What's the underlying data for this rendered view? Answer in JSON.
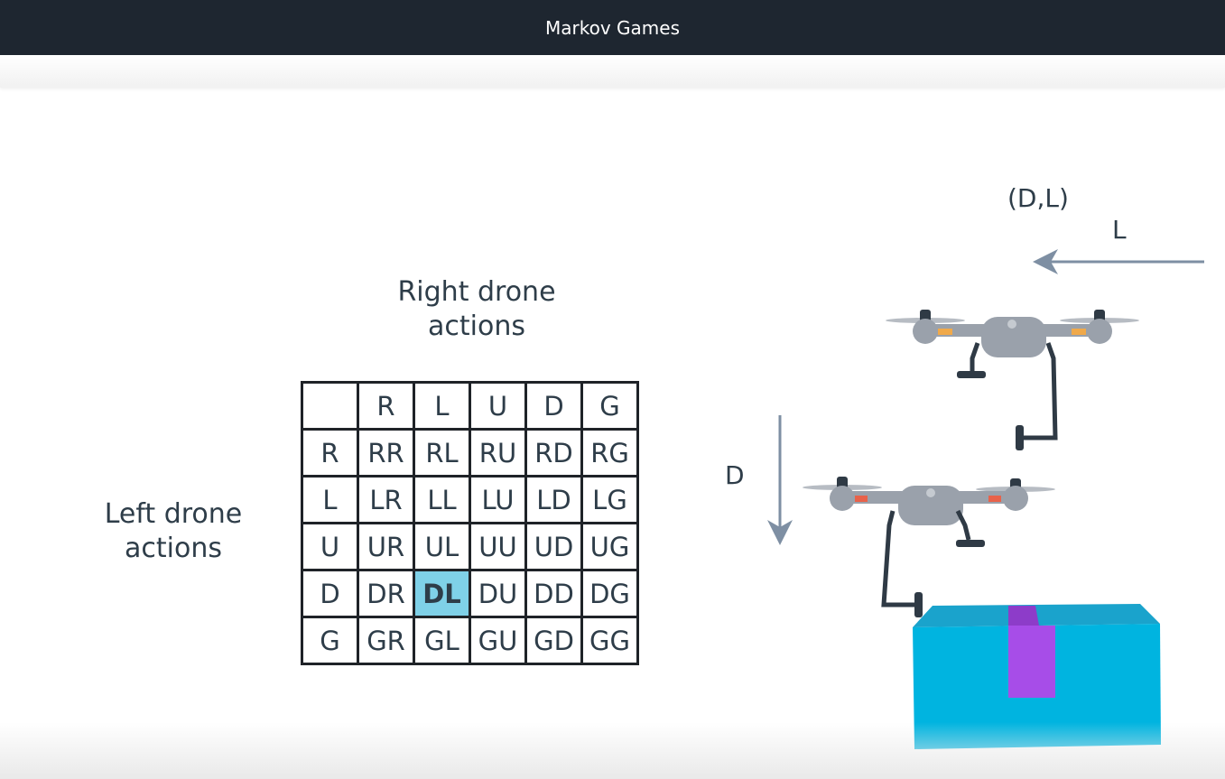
{
  "header": {
    "title": "Markov Games"
  },
  "slide": {
    "right_label": "Right drone actions",
    "left_label": "Left drone actions",
    "matrix": {
      "column_headers": [
        "",
        "R",
        "L",
        "U",
        "D",
        "G"
      ],
      "rows": [
        [
          "R",
          "RR",
          "RL",
          "RU",
          "RD",
          "RG"
        ],
        [
          "L",
          "LR",
          "LL",
          "LU",
          "LD",
          "LG"
        ],
        [
          "U",
          "UR",
          "UL",
          "UU",
          "UD",
          "UG"
        ],
        [
          "D",
          "DR",
          "DL",
          "DU",
          "DD",
          "DG"
        ],
        [
          "G",
          "GR",
          "GL",
          "GU",
          "GD",
          "GG"
        ]
      ],
      "highlighted": "DL",
      "highlight_color": "#7fd1e8"
    },
    "joint_action": "(D,L)",
    "upper_arrow_label": "L",
    "lower_arrow_label": "D",
    "colors": {
      "box": "#00b4e0",
      "box_strap": "#a74de8",
      "drone_body": "#9aa1ab",
      "arrow": "#7e8fa3",
      "header_bg": "#1e2630"
    }
  }
}
